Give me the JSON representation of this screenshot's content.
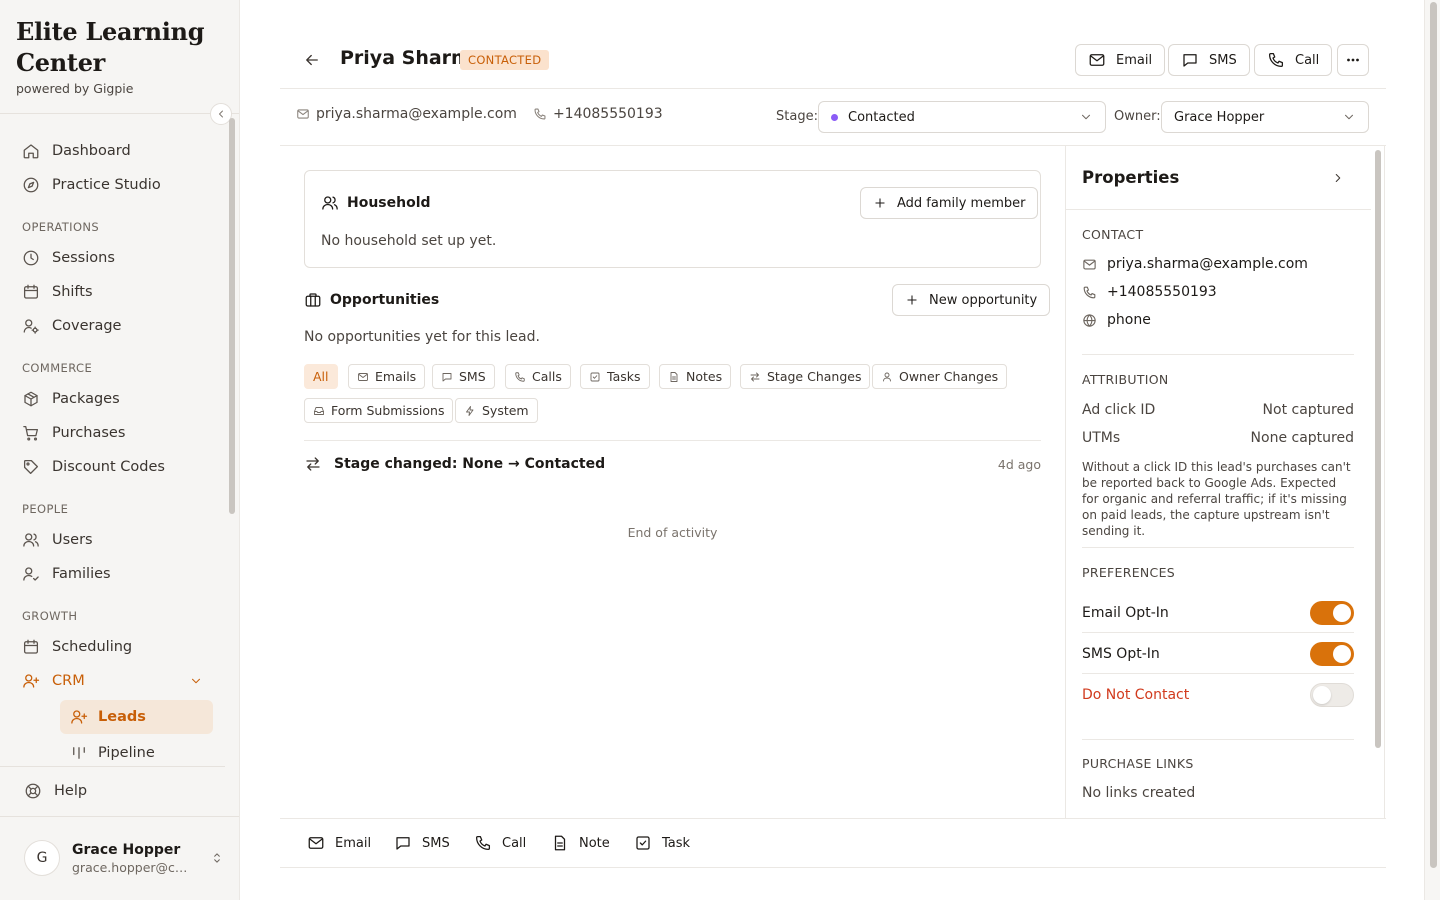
{
  "brand": {
    "title": "Elite Learning Center",
    "subtitle": "powered by Gigpie"
  },
  "sidebar": {
    "items": [
      {
        "label": "Dashboard",
        "icon": "home-icon"
      },
      {
        "label": "Practice Studio",
        "icon": "compass-icon"
      }
    ],
    "sections": [
      {
        "title": "OPERATIONS",
        "items": [
          {
            "label": "Sessions",
            "icon": "clock-icon"
          },
          {
            "label": "Shifts",
            "icon": "calendar-icon"
          },
          {
            "label": "Coverage",
            "icon": "user-settings-icon"
          }
        ]
      },
      {
        "title": "COMMERCE",
        "items": [
          {
            "label": "Packages",
            "icon": "package-icon"
          },
          {
            "label": "Purchases",
            "icon": "cart-icon"
          },
          {
            "label": "Discount Codes",
            "icon": "tag-icon"
          }
        ]
      },
      {
        "title": "PEOPLE",
        "items": [
          {
            "label": "Users",
            "icon": "users-icon"
          },
          {
            "label": "Families",
            "icon": "user-check-icon"
          }
        ]
      },
      {
        "title": "GROWTH",
        "items": [
          {
            "label": "Scheduling",
            "icon": "calendar-icon"
          },
          {
            "label": "CRM",
            "icon": "user-plus-icon",
            "active": true,
            "expanded": true
          }
        ]
      }
    ],
    "sub_items": [
      {
        "label": "Leads",
        "icon": "user-plus-icon",
        "active": true
      },
      {
        "label": "Pipeline",
        "icon": "kanban-icon"
      }
    ],
    "help": {
      "label": "Help",
      "icon": "lifebuoy-icon"
    },
    "user": {
      "initial": "G",
      "name": "Grace Hopper",
      "email": "grace.hopper@co..."
    }
  },
  "header": {
    "name": "Priya Sharma",
    "status": "CONTACTED",
    "actions": {
      "email": "Email",
      "sms": "SMS",
      "call": "Call"
    },
    "email": "priya.sharma@example.com",
    "phone": "+14085550193",
    "stage_label": "Stage:",
    "stage_value": "Contacted",
    "owner_label": "Owner:",
    "owner_value": "Grace Hopper"
  },
  "household": {
    "title": "Household",
    "add_button": "Add family member",
    "empty": "No household set up yet."
  },
  "opportunities": {
    "title": "Opportunities",
    "new_button": "New opportunity",
    "empty": "No opportunities yet for this lead."
  },
  "filters": [
    {
      "label": "All",
      "icon": "",
      "active": true
    },
    {
      "label": "Emails",
      "icon": "mail-icon"
    },
    {
      "label": "SMS",
      "icon": "message-icon"
    },
    {
      "label": "Calls",
      "icon": "phone-icon"
    },
    {
      "label": "Tasks",
      "icon": "check-square-icon"
    },
    {
      "label": "Notes",
      "icon": "file-icon"
    },
    {
      "label": "Stage Changes",
      "icon": "swap-icon"
    },
    {
      "label": "Owner Changes",
      "icon": "user-icon"
    },
    {
      "label": "Form Submissions",
      "icon": "inbox-icon"
    },
    {
      "label": "System",
      "icon": "bolt-icon"
    }
  ],
  "activity": {
    "items": [
      {
        "text": "Stage changed: None → Contacted",
        "time": "4d ago",
        "icon": "swap-icon"
      }
    ],
    "end": "End of activity"
  },
  "properties": {
    "title": "Properties",
    "contact": {
      "label": "CONTACT",
      "email": "priya.sharma@example.com",
      "phone": "+14085550193",
      "source": "phone"
    },
    "attribution": {
      "label": "ATTRIBUTION",
      "rows": [
        {
          "key": "Ad click ID",
          "value": "Not captured"
        },
        {
          "key": "UTMs",
          "value": "None captured"
        }
      ],
      "note": "Without a click ID this lead's purchases can't be reported back to Google Ads. Expected for organic and referral traffic; if it's missing on paid leads, the capture upstream isn't sending it."
    },
    "preferences": {
      "label": "PREFERENCES",
      "items": [
        {
          "label": "Email Opt-In",
          "on": true
        },
        {
          "label": "SMS Opt-In",
          "on": true
        },
        {
          "label": "Do Not Contact",
          "on": false
        }
      ]
    },
    "purchase_links": {
      "label": "PURCHASE LINKS",
      "empty": "No links created"
    }
  },
  "quick_actions": {
    "email": "Email",
    "sms": "SMS",
    "call": "Call",
    "note": "Note",
    "task": "Task"
  },
  "colors": {
    "accent": "#c85f08",
    "toggle_on": "#d9720b",
    "stage_dot": "#8b5cf6",
    "danger": "#d13a1d"
  }
}
